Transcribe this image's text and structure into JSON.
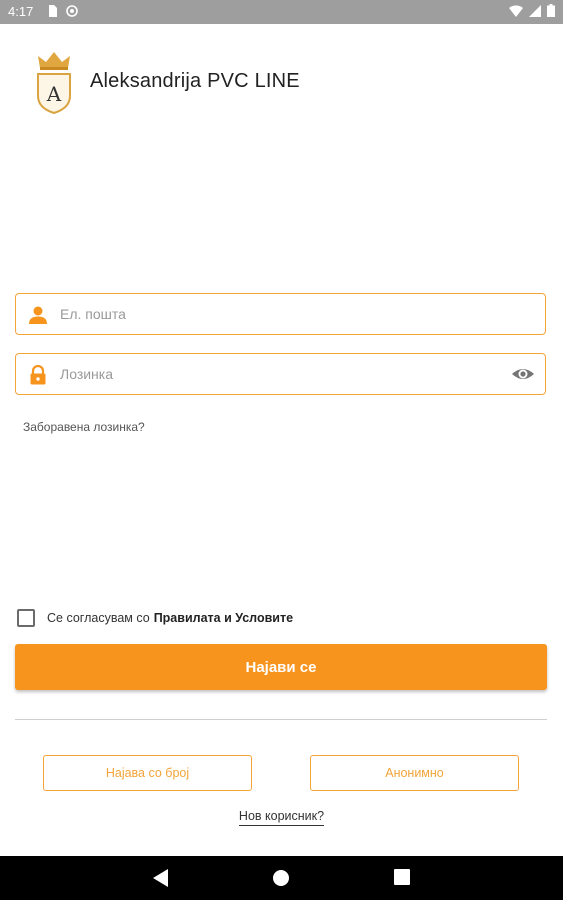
{
  "status_bar": {
    "time": "4:17"
  },
  "app": {
    "title": "Aleksandrija PVC LINE",
    "logo_letter": "A"
  },
  "login": {
    "email_placeholder": "Ел. пошта",
    "password_placeholder": "Лозинка",
    "forgot_password": "Заборавена лозинка?",
    "agree_text": "Се согласувам со",
    "agree_link": "Правилата и Условите",
    "agree_checked": false,
    "login_button": "Најави се",
    "phone_login_button": "Најава со број",
    "anonymous_button": "Анонимно",
    "new_user": "Нов корисник?"
  },
  "colors": {
    "accent": "#f7941d",
    "border": "#f3a43a",
    "status_bar": "#9e9e9e",
    "nav_bar": "#000000"
  },
  "icons": [
    "sim-card-icon",
    "circle-icon",
    "wifi-icon",
    "signal-icon",
    "battery-icon",
    "user-icon",
    "lock-icon",
    "eye-icon",
    "back-icon",
    "home-icon",
    "recents-icon"
  ]
}
